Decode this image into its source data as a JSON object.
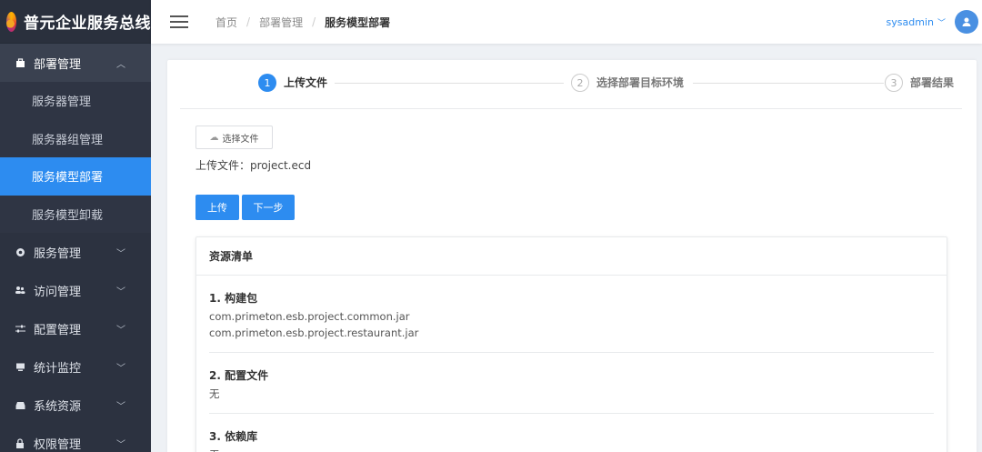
{
  "brand": {
    "title": "普元企业服务总线"
  },
  "sidebar": {
    "groups": [
      {
        "label": "部署管理",
        "icon": "briefcase-icon",
        "open": true,
        "items": [
          {
            "label": "服务器管理"
          },
          {
            "label": "服务器组管理"
          },
          {
            "label": "服务模型部署",
            "active": true
          },
          {
            "label": "服务模型卸载"
          }
        ]
      },
      {
        "label": "服务管理",
        "icon": "circle-icon"
      },
      {
        "label": "访问管理",
        "icon": "users-icon"
      },
      {
        "label": "配置管理",
        "icon": "sliders-icon"
      },
      {
        "label": "统计监控",
        "icon": "monitor-icon"
      },
      {
        "label": "系统资源",
        "icon": "drive-icon"
      },
      {
        "label": "权限管理",
        "icon": "lock-icon"
      }
    ]
  },
  "header": {
    "breadcrumb": [
      "首页",
      "部署管理",
      "服务模型部署"
    ],
    "user": "sysadmin"
  },
  "steps": [
    {
      "num": "1",
      "title": "上传文件",
      "state": "active"
    },
    {
      "num": "2",
      "title": "选择部署目标环境",
      "state": "idle"
    },
    {
      "num": "3",
      "title": "部署结果",
      "state": "idle"
    }
  ],
  "upload": {
    "choose_label": "选择文件",
    "info": "上传文件：project.ecd",
    "upload_button": "上传",
    "next_button": "下一步"
  },
  "resource_list": {
    "title": "资源清单",
    "sections": [
      {
        "title": "1. 构建包",
        "lines": [
          "com.primeton.esb.project.common.jar",
          "com.primeton.esb.project.restaurant.jar"
        ]
      },
      {
        "title": "2. 配置文件",
        "lines": [
          "无"
        ]
      },
      {
        "title": "3. 依赖库",
        "lines": [
          "无"
        ]
      }
    ]
  },
  "colors": {
    "accent": "#2d8cf0",
    "sidebar": "#2c3240"
  }
}
